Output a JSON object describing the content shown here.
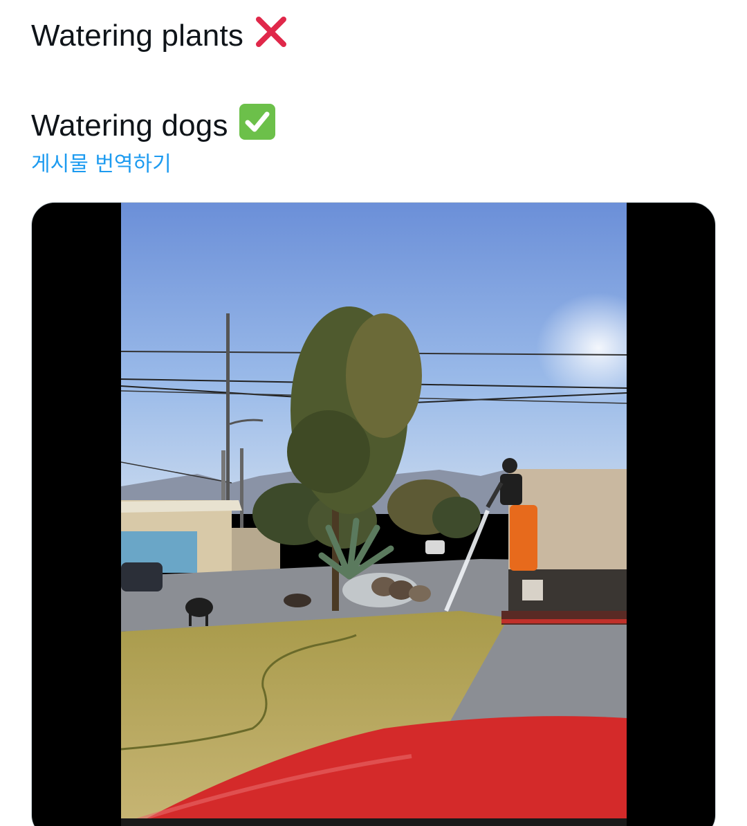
{
  "tweet": {
    "line1_text": "Watering plants",
    "line1_emoji": "cross-mark-icon",
    "line2_text": "Watering dogs",
    "line2_emoji": "check-mark-button-icon",
    "translate_label": "게시물 번역하기"
  },
  "colors": {
    "link": "#1d9bf0",
    "text": "#0f1419",
    "cross": "#e0284a",
    "check_bg": "#6cc04a"
  },
  "media": {
    "type": "video",
    "scene": "video-still-icon"
  }
}
